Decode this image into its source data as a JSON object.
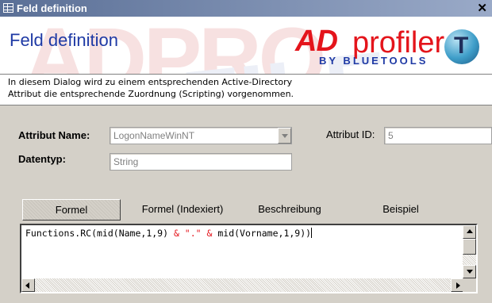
{
  "window": {
    "title": "Feld definition",
    "close_glyph": "✕"
  },
  "banner": {
    "title": "Feld definition",
    "logo": {
      "brand_ad": "AD",
      "brand_profiler": "profiler",
      "by_line": "BY BLUETOOLS",
      "ball_letter": "T"
    }
  },
  "description": {
    "line1": "In diesem Dialog wird zu einem entsprechenden Active-Directory",
    "line2": "Attribut die entsprechende Zuordnung (Scripting) vorgenommen."
  },
  "form": {
    "attribut_name_label": "Attribut Name:",
    "attribut_name_value": "LogonNameWinNT",
    "attribut_id_label": "Attribut ID:",
    "attribut_id_value": "5",
    "datentyp_label": "Datentyp:",
    "datentyp_value": "String"
  },
  "tabs": [
    {
      "label": "Formel",
      "active": true
    },
    {
      "label": "Formel (Indexiert)",
      "active": false
    },
    {
      "label": "Beschreibung",
      "active": false
    },
    {
      "label": "Beispiel",
      "active": false
    }
  ],
  "editor": {
    "code_part1": "Functions.RC(mid(Name,1,9) ",
    "code_amp1": "&",
    "code_str": " \".\" ",
    "code_amp2": "&",
    "code_part2": " mid(Vorname,1,9))"
  },
  "colors": {
    "accent_red": "#e4141b",
    "accent_blue": "#1f3aa5",
    "dialog_bg": "#d4d0c8"
  }
}
